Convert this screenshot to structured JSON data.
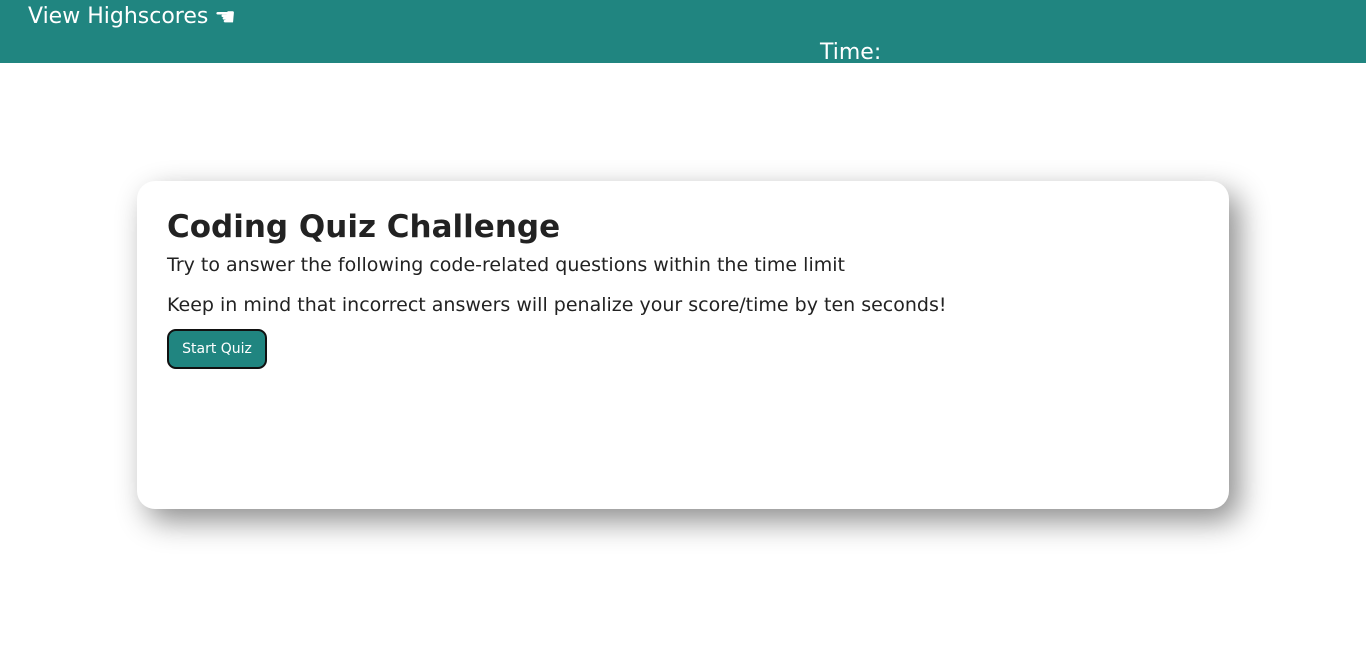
{
  "header": {
    "highscores_label": "View Highscores",
    "highscores_icon": "pointing-hand-icon",
    "timer_label": "Time:",
    "timer_value": ""
  },
  "quiz": {
    "title": "Coding Quiz Challenge",
    "instructions": "Try to answer the following code-related questions within the time limit",
    "warning": "Keep in mind that incorrect answers will penalize your score/time by ten seconds!",
    "start_label": "Start Quiz"
  },
  "colors": {
    "accent": "#208580",
    "background": "#ffffff",
    "text": "#222222"
  }
}
